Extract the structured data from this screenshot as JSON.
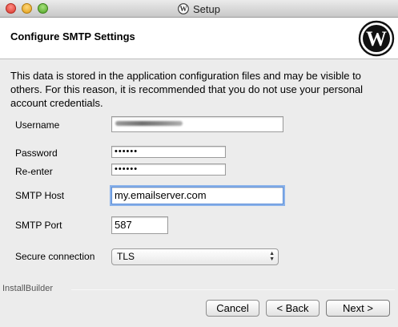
{
  "window": {
    "title": "Setup"
  },
  "header": {
    "title": "Configure SMTP Settings"
  },
  "intro_text": "This data is stored in the application configuration files and may be visible to others. For this reason, it is recommended that you do not use your personal account credentials.",
  "form": {
    "username": {
      "label": "Username",
      "value": ""
    },
    "password": {
      "label": "Password",
      "value": "••••••"
    },
    "reenter": {
      "label": "Re-enter",
      "value": "••••••"
    },
    "smtp_host": {
      "label": "SMTP Host",
      "value": "my.emailserver.com"
    },
    "smtp_port": {
      "label": "SMTP Port",
      "value": "587"
    },
    "secure_connection": {
      "label": "Secure connection",
      "selected": "TLS"
    }
  },
  "footer": {
    "brand": "InstallBuilder",
    "cancel_label": "Cancel",
    "back_label": "< Back",
    "next_label": "Next >"
  },
  "colors": {
    "focus_ring": "#8ab2ea",
    "header_bg": "#ffffff",
    "window_bg": "#ececec"
  },
  "icons": {
    "logo": "wordpress-logo-icon"
  }
}
